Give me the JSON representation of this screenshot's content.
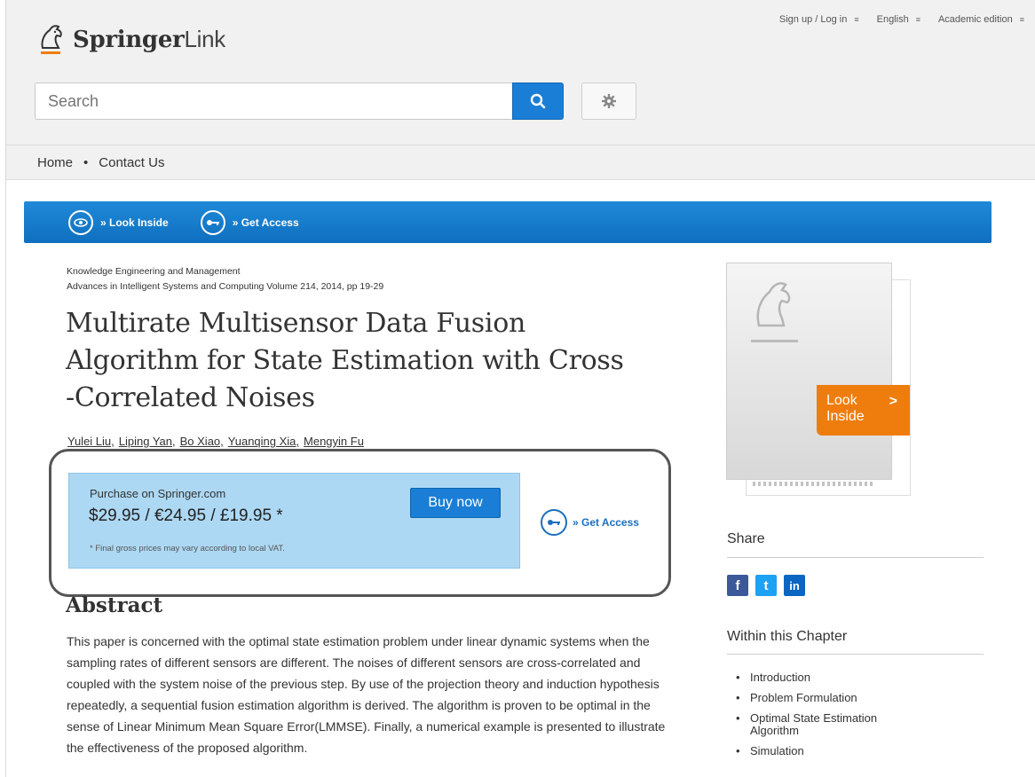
{
  "header": {
    "utility": {
      "signup": "Sign up / Log in",
      "language": "English",
      "edition": "Academic edition"
    },
    "logo": {
      "bold": "Springer",
      "light": "Link"
    },
    "search": {
      "placeholder": "Search"
    },
    "nav": {
      "home": "Home",
      "separator": "•",
      "contact": "Contact Us"
    }
  },
  "bluebar": {
    "look_inside": "» Look Inside",
    "get_access": "» Get Access"
  },
  "article": {
    "book": "Knowledge Engineering and Management",
    "series": "Advances in Intelligent Systems and Computing Volume 214, 2014, pp 19-29",
    "title_line1": "Multirate Multisensor Data Fusion",
    "title_line2": "Algorithm for State Estimation with Cross",
    "title_line3": "-Correlated Noises",
    "authors": [
      "Yulei Liu,",
      "Liping Yan,",
      "Bo Xiao,",
      "Yuanqing Xia,",
      "Mengyin Fu"
    ]
  },
  "purchase": {
    "title": "Purchase on Springer.com",
    "price": "$29.95 / €24.95 / £19.95 *",
    "buy": "Buy now",
    "vat_note": "* Final gross prices may vary according to local VAT.",
    "get_access": "» Get Access"
  },
  "abstract": {
    "heading": "Abstract",
    "text": "This paper is concerned with the optimal state estimation problem under linear dynamic systems when the sampling rates of different sensors are different. The noises of different sensors are cross-correlated and coupled with the system noise of the previous step. By use of the projection theory and induction hypothesis repeatedly, a sequential fusion estimation algorithm is derived. The algorithm is proven to be optimal in the sense of Linear Minimum Mean Square Error(LMMSE). Finally, a numerical example is presented to illustrate the effectiveness of the proposed algorithm."
  },
  "sidebar": {
    "look_inside_1": "Look",
    "look_inside_2": "Inside",
    "look_inside_chevron": ">",
    "share": "Share",
    "social": {
      "facebook": "f",
      "twitter": "t",
      "linkedin": "in"
    },
    "within": "Within this Chapter",
    "toc": [
      "Introduction",
      "Problem Formulation",
      "Optimal State Estimation Algorithm",
      "Simulation"
    ]
  },
  "colors": {
    "accent_blue": "#1a7ed6",
    "orange": "#ef7d0e",
    "purchase_bg": "#add8f3"
  }
}
